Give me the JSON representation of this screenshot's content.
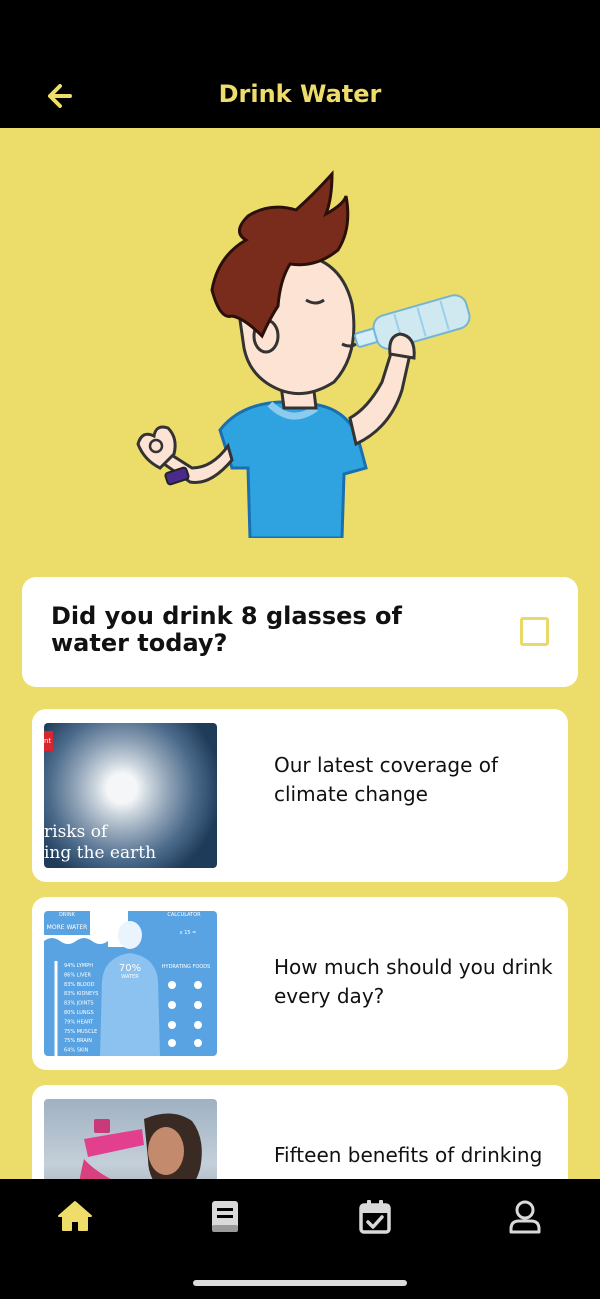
{
  "header": {
    "title": "Drink Water",
    "back_icon": "arrow-left-icon"
  },
  "colors": {
    "accent": "#efdd6a",
    "background": "#ecdd6b",
    "bar": "#000000",
    "card": "#ffffff"
  },
  "hero": {
    "illustration": "boy-drinking-water-illustration"
  },
  "question": {
    "text": "Did you drink 8 glasses of water today?",
    "checked": false
  },
  "articles": [
    {
      "title": "Our latest coverage of climate change",
      "thumb_text_line1": "risks of",
      "thumb_text_line2": "ing the earth",
      "thumb_badge": "nt"
    },
    {
      "title": " How much should you drink every day?",
      "thumb_header": "MORE WATER",
      "thumb_header_top": "DRINK",
      "thumb_calc": "CALCULATOR",
      "thumb_calc_formula": "x 15 =",
      "thumb_percent": "70%",
      "thumb_percent_label": "WATER",
      "thumb_foods": "HYDRATING FOODS",
      "thumb_list": [
        "94% LYMPH",
        "86% LIVER",
        "83% BLOOD",
        "83% KIDNEYS",
        "83% JOINTS",
        "80% LUNGS",
        "79% HEART",
        "75% MUSCLE",
        "75% BRAIN",
        "64% SKIN"
      ]
    },
    {
      "title": "Fifteen benefits of drinking"
    }
  ],
  "nav": {
    "items": [
      "home-icon",
      "book-icon",
      "calendar-check-icon",
      "profile-icon"
    ],
    "active": "home-icon"
  }
}
